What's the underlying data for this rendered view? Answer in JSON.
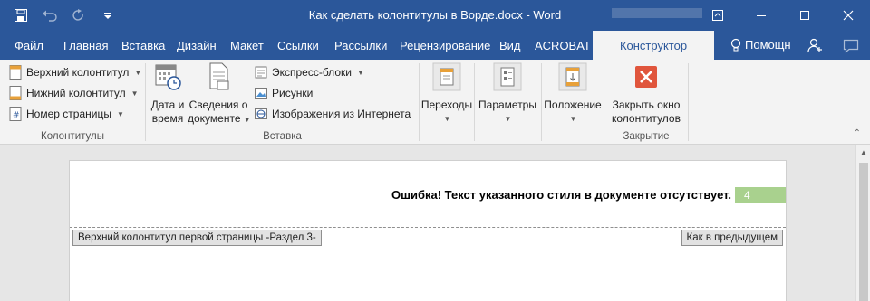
{
  "window": {
    "title": "Как сделать колонтитулы в Ворде.docx - Word",
    "quick_access": [
      "save-icon",
      "undo-icon",
      "redo-icon",
      "customize-icon"
    ],
    "controls": [
      "ribbon-display-icon",
      "minimize-icon",
      "maximize-icon",
      "close-icon"
    ]
  },
  "tabs": {
    "items": [
      "Файл",
      "Главная",
      "Вставка",
      "Дизайн",
      "Макет",
      "Ссылки",
      "Рассылки",
      "Рецензирование",
      "Вид",
      "ACROBAT",
      "Конструктор"
    ],
    "active": "Конструктор",
    "help": "Помощн"
  },
  "ribbon": {
    "headers_group": {
      "label": "Колонтитулы",
      "header": "Верхний колонтитул",
      "footer": "Нижний колонтитул",
      "page_number": "Номер страницы"
    },
    "insert_group": {
      "label": "Вставка",
      "datetime_line1": "Дата и",
      "datetime_line2": "время",
      "docinfo_line1": "Сведения о",
      "docinfo_line2": "документе",
      "quick_parts": "Экспресс-блоки",
      "pictures": "Рисунки",
      "online_pictures": "Изображения из Интернета"
    },
    "navigation": {
      "label": "Переходы"
    },
    "options": {
      "label": "Параметры"
    },
    "position": {
      "label": "Положение"
    },
    "close_group": {
      "label": "Закрытие",
      "close_line1": "Закрыть окно",
      "close_line2": "колонтитулов"
    }
  },
  "document": {
    "error_text": "Ошибка! Текст указанного стиля в документе отсутствует.",
    "page_number": "4",
    "header_tag": "Верхний колонтитул первой страницы -Раздел 3-",
    "link_tag": "Как в предыдущем"
  },
  "colors": {
    "titlebar": "#2b579a",
    "ribbon": "#f3f3f3",
    "page_number_bg": "#a9d18e",
    "close_icon": "#e0553c"
  }
}
